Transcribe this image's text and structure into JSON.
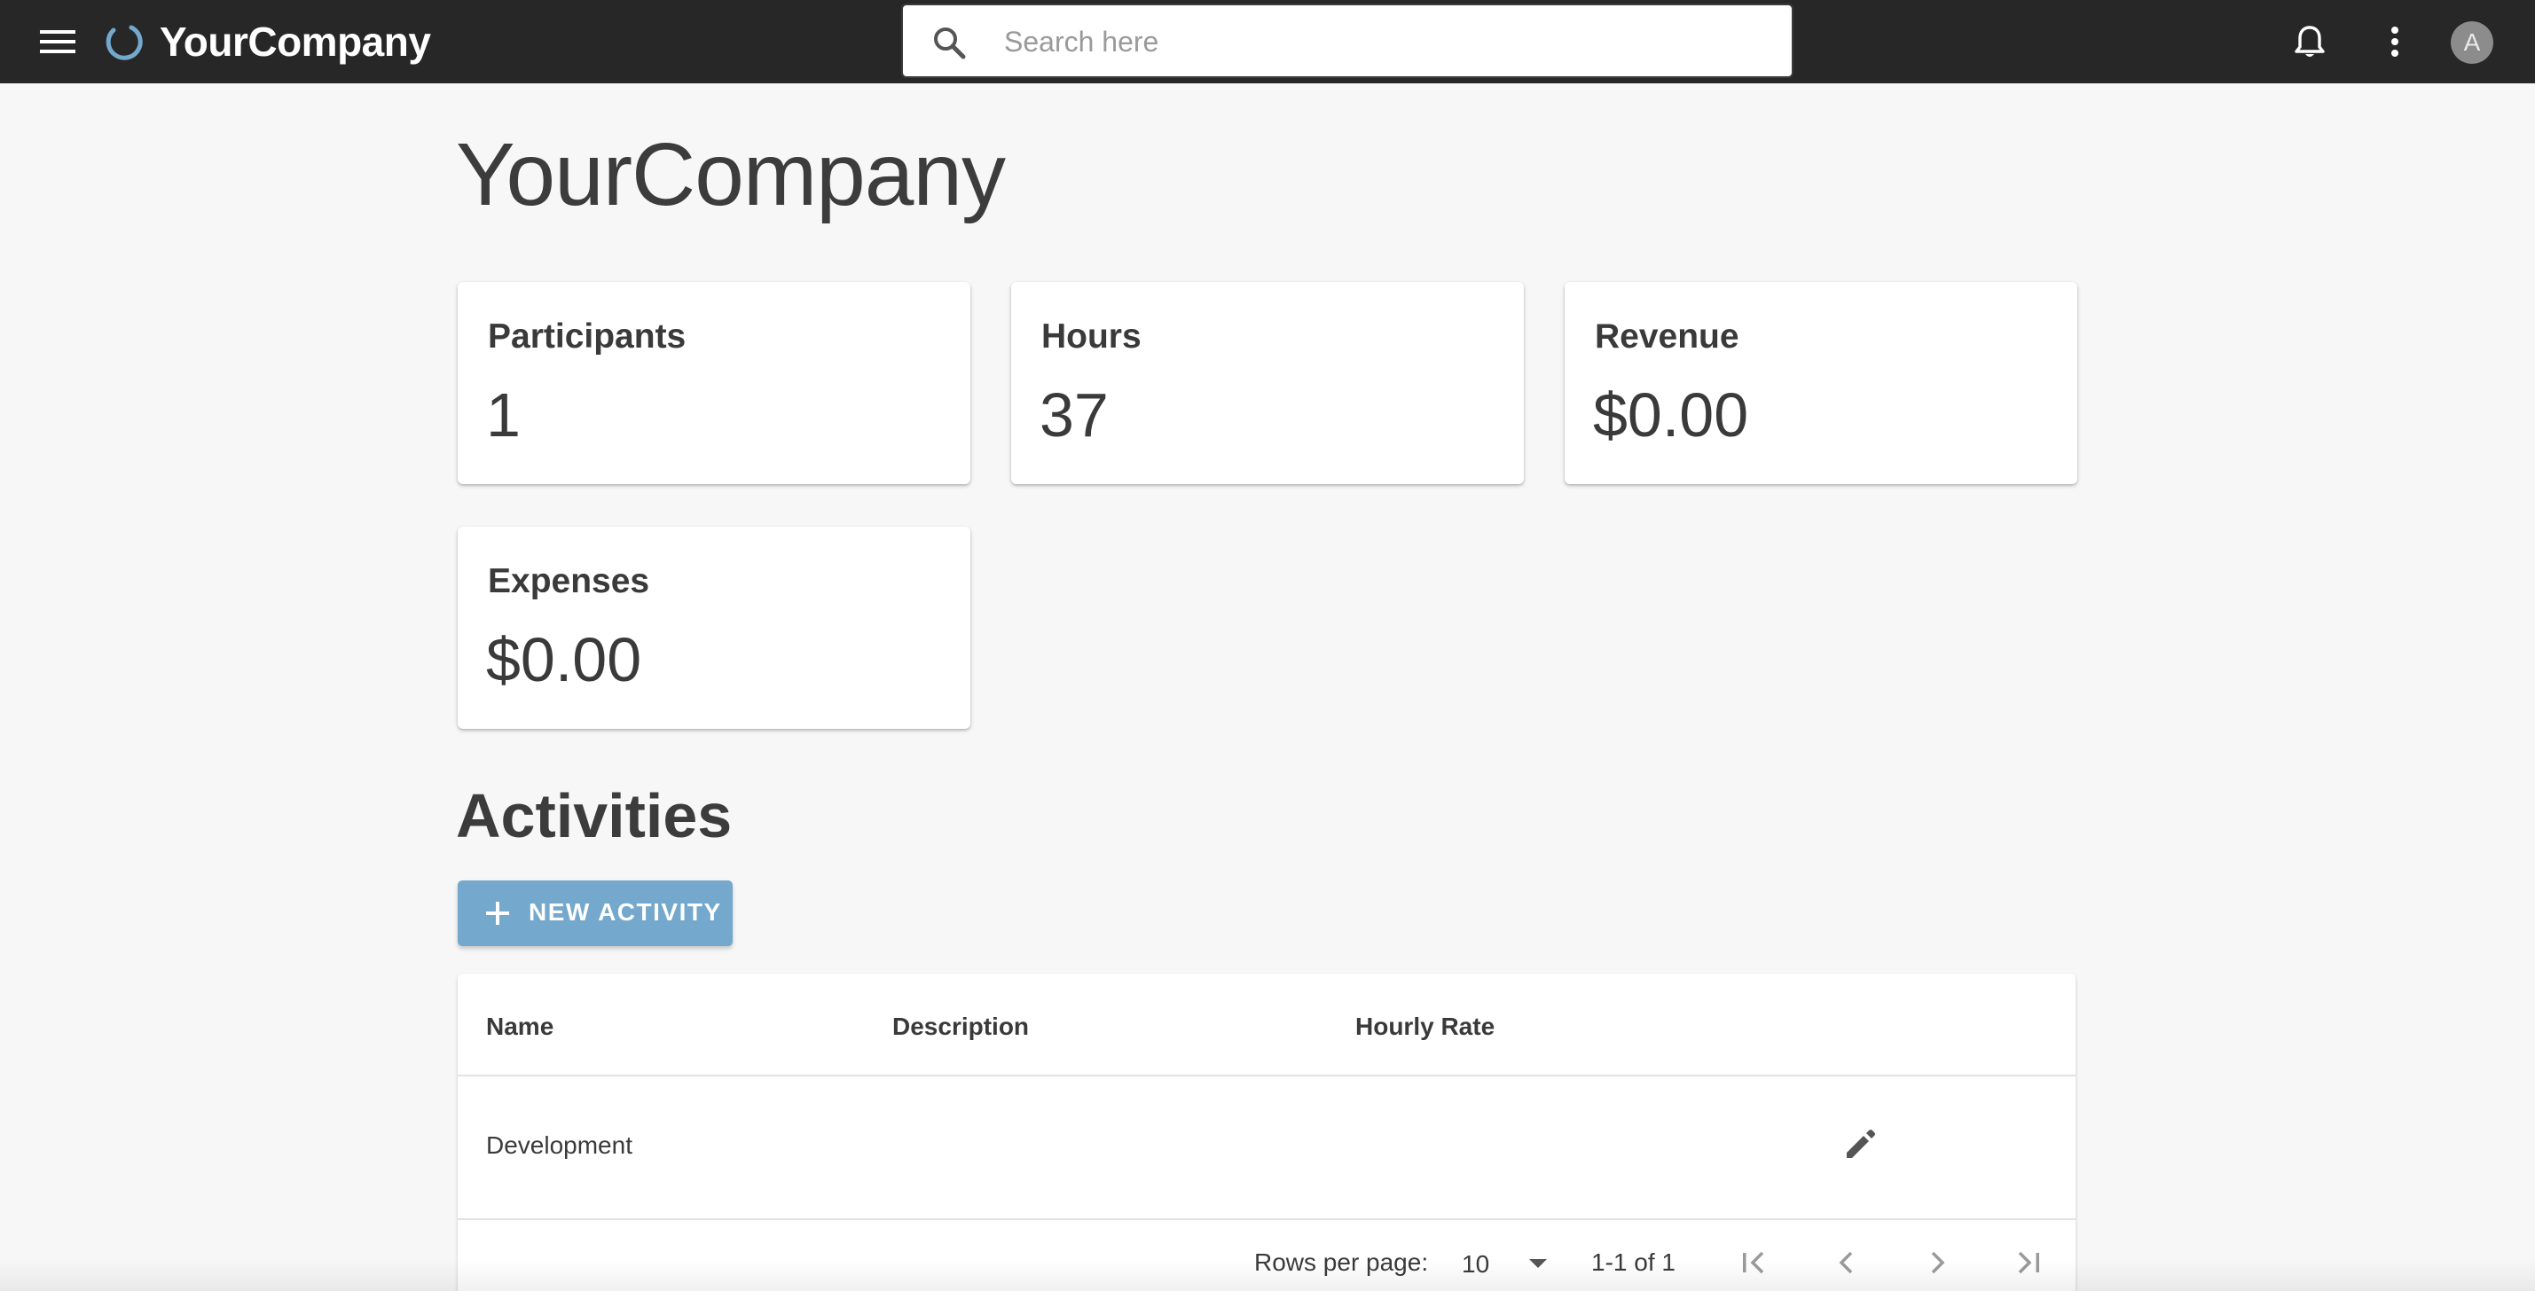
{
  "appbar": {
    "menu_icon": "hamburger-menu-icon",
    "brand_logo_icon": "ring-logo-icon",
    "brand_name": "YourCompany",
    "search": {
      "placeholder": "Search here",
      "value": "",
      "icon": "search-icon"
    },
    "notifications_icon": "bell-icon",
    "more_icon": "vertical-dots-icon",
    "avatar_initial": "A",
    "colors": {
      "background": "#272727",
      "brand_accent": "#74a8cc"
    }
  },
  "page": {
    "title": "YourCompany"
  },
  "stats": [
    {
      "label": "Participants",
      "value": "1"
    },
    {
      "label": "Hours",
      "value": "37"
    },
    {
      "label": "Revenue",
      "value": "$0.00"
    },
    {
      "label": "Expenses",
      "value": "$0.00"
    }
  ],
  "activities": {
    "title": "Activities",
    "new_button": {
      "label": "NEW ACTIVITY",
      "icon": "plus-icon",
      "color": "#74a8cc"
    },
    "table": {
      "columns": [
        "Name",
        "Description",
        "Hourly Rate"
      ],
      "rows": [
        {
          "name": "Development",
          "description": "",
          "hourly_rate": "",
          "action_icon": "pencil-edit-icon"
        }
      ],
      "footer": {
        "rows_per_page_label": "Rows per page:",
        "rows_per_page_value": "10",
        "range_text": "1-1 of 1",
        "pager_icons": [
          "first-page-icon",
          "previous-page-icon",
          "next-page-icon",
          "last-page-icon"
        ]
      }
    }
  }
}
